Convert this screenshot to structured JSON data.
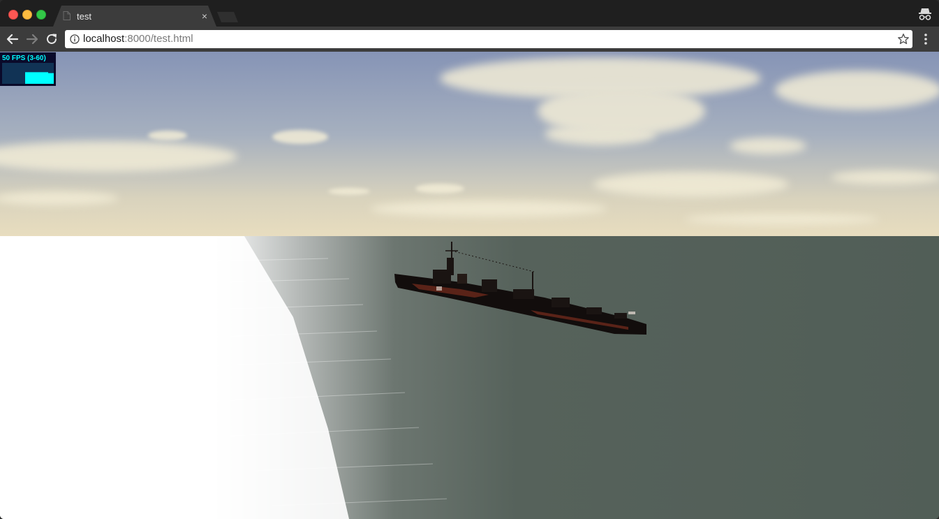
{
  "window": {
    "tab_title": "test",
    "tab_close_glyph": "×"
  },
  "toolbar": {
    "url_host": "localhost",
    "url_rest": ":8000/test.html"
  },
  "stats": {
    "fps_text": "50 FPS (3-60)",
    "fps_value": 50,
    "fps_min": 3,
    "fps_max": 60
  },
  "icons": {
    "back": "arrow-left-icon",
    "forward": "arrow-right-icon",
    "reload": "reload-icon",
    "info": "info-icon",
    "bookmark": "star-icon",
    "menu": "kebab-menu-icon",
    "incognito": "incognito-icon",
    "favicon": "document-icon"
  },
  "colors": {
    "fps_text": "#00ffff",
    "fps_bg": "#0a0a2a",
    "sea": "#52605a",
    "sky_top": "#8a98b8",
    "sky_horizon": "#e6dcc0"
  }
}
